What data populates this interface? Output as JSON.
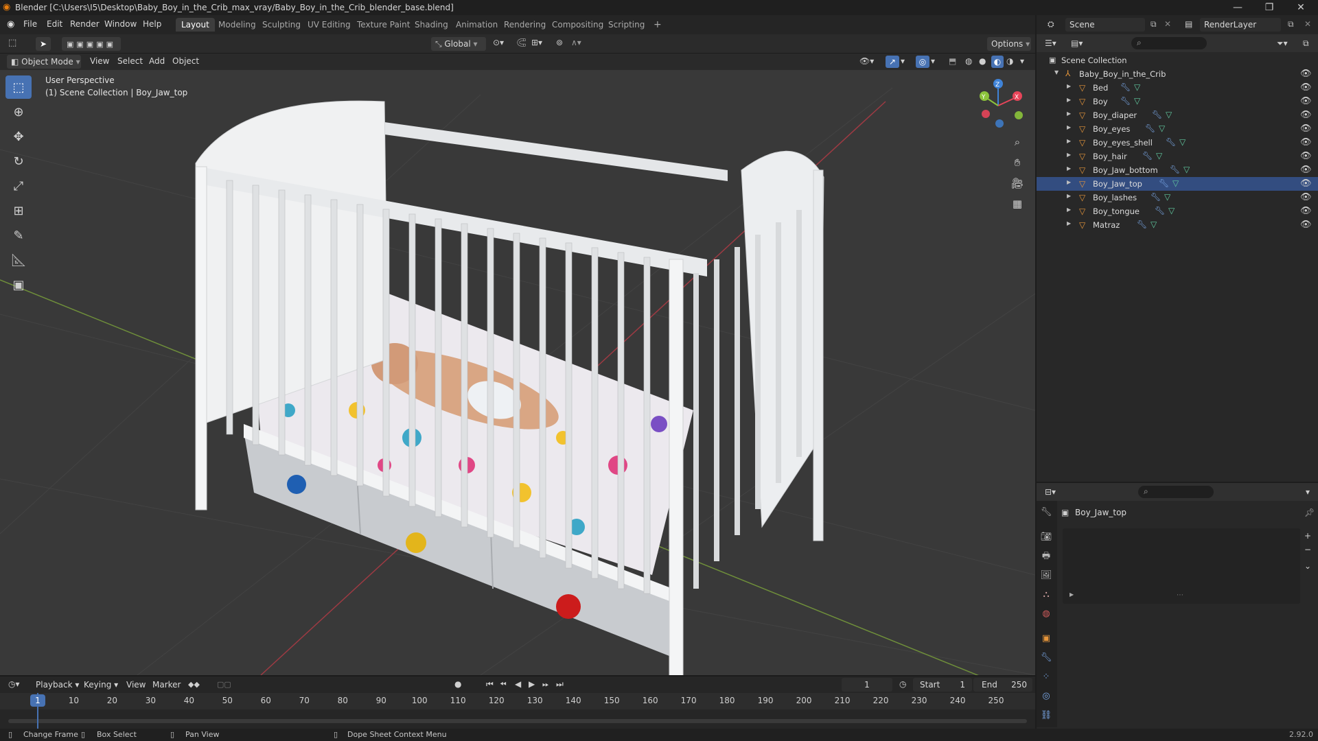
{
  "window": {
    "title": "Blender [C:\\Users\\I5\\Desktop\\Baby_Boy_in_the_Crib_max_vray/Baby_Boy_in_the_Crib_blender_base.blend]",
    "minimize": "—",
    "maximize": "❐",
    "close": "✕"
  },
  "menu": [
    "File",
    "Edit",
    "Render",
    "Window",
    "Help"
  ],
  "workspaces": [
    "Layout",
    "Modeling",
    "Sculpting",
    "UV Editing",
    "Texture Paint",
    "Shading",
    "Animation",
    "Rendering",
    "Compositing",
    "Scripting"
  ],
  "workspace_add": "+",
  "scene": {
    "name": "Scene",
    "view_layer": "RenderLayer"
  },
  "toolbar": {
    "transform_orientation": "Global",
    "options": "Options"
  },
  "viewport_header": {
    "mode": "Object Mode",
    "menus": [
      "View",
      "Select",
      "Add",
      "Object"
    ]
  },
  "viewport": {
    "perspective_label": "User Perspective",
    "context_label": "(1) Scene Collection | Boy_Jaw_top",
    "gizmo": {
      "x": "X",
      "y": "Y",
      "z": "Z"
    }
  },
  "outliner": {
    "root": "Scene Collection",
    "collection": "Baby_Boy_in_the_Crib",
    "objects": [
      "Bed",
      "Boy",
      "Boy_diaper",
      "Boy_eyes",
      "Boy_eyes_shell",
      "Boy_hair",
      "Boy_Jaw_bottom",
      "Boy_Jaw_top",
      "Boy_lashes",
      "Boy_tongue",
      "Matraz"
    ],
    "selected": "Boy_Jaw_top"
  },
  "properties": {
    "object_name": "Boy_Jaw_top"
  },
  "timeline": {
    "menus": [
      "Playback",
      "Keying",
      "View",
      "Marker"
    ],
    "current_frame": "1",
    "start_label": "Start",
    "start": "1",
    "end_label": "End",
    "end": "250",
    "ticks": [
      "1",
      "10",
      "20",
      "30",
      "40",
      "50",
      "60",
      "70",
      "80",
      "90",
      "100",
      "110",
      "120",
      "130",
      "140",
      "150",
      "160",
      "170",
      "180",
      "190",
      "200",
      "210",
      "220",
      "230",
      "240",
      "250"
    ]
  },
  "status": {
    "hints": [
      "Change Frame",
      "Box Select",
      "Pan View",
      "Dope Sheet Context Menu"
    ],
    "version": "2.92.0"
  },
  "colors": {
    "accent": "#4772b3",
    "selection": "#334d80",
    "axis_x": "#e8455a",
    "axis_y": "#8cc43b",
    "axis_z": "#3f83d8",
    "mesh_icon": "#e5953a"
  }
}
